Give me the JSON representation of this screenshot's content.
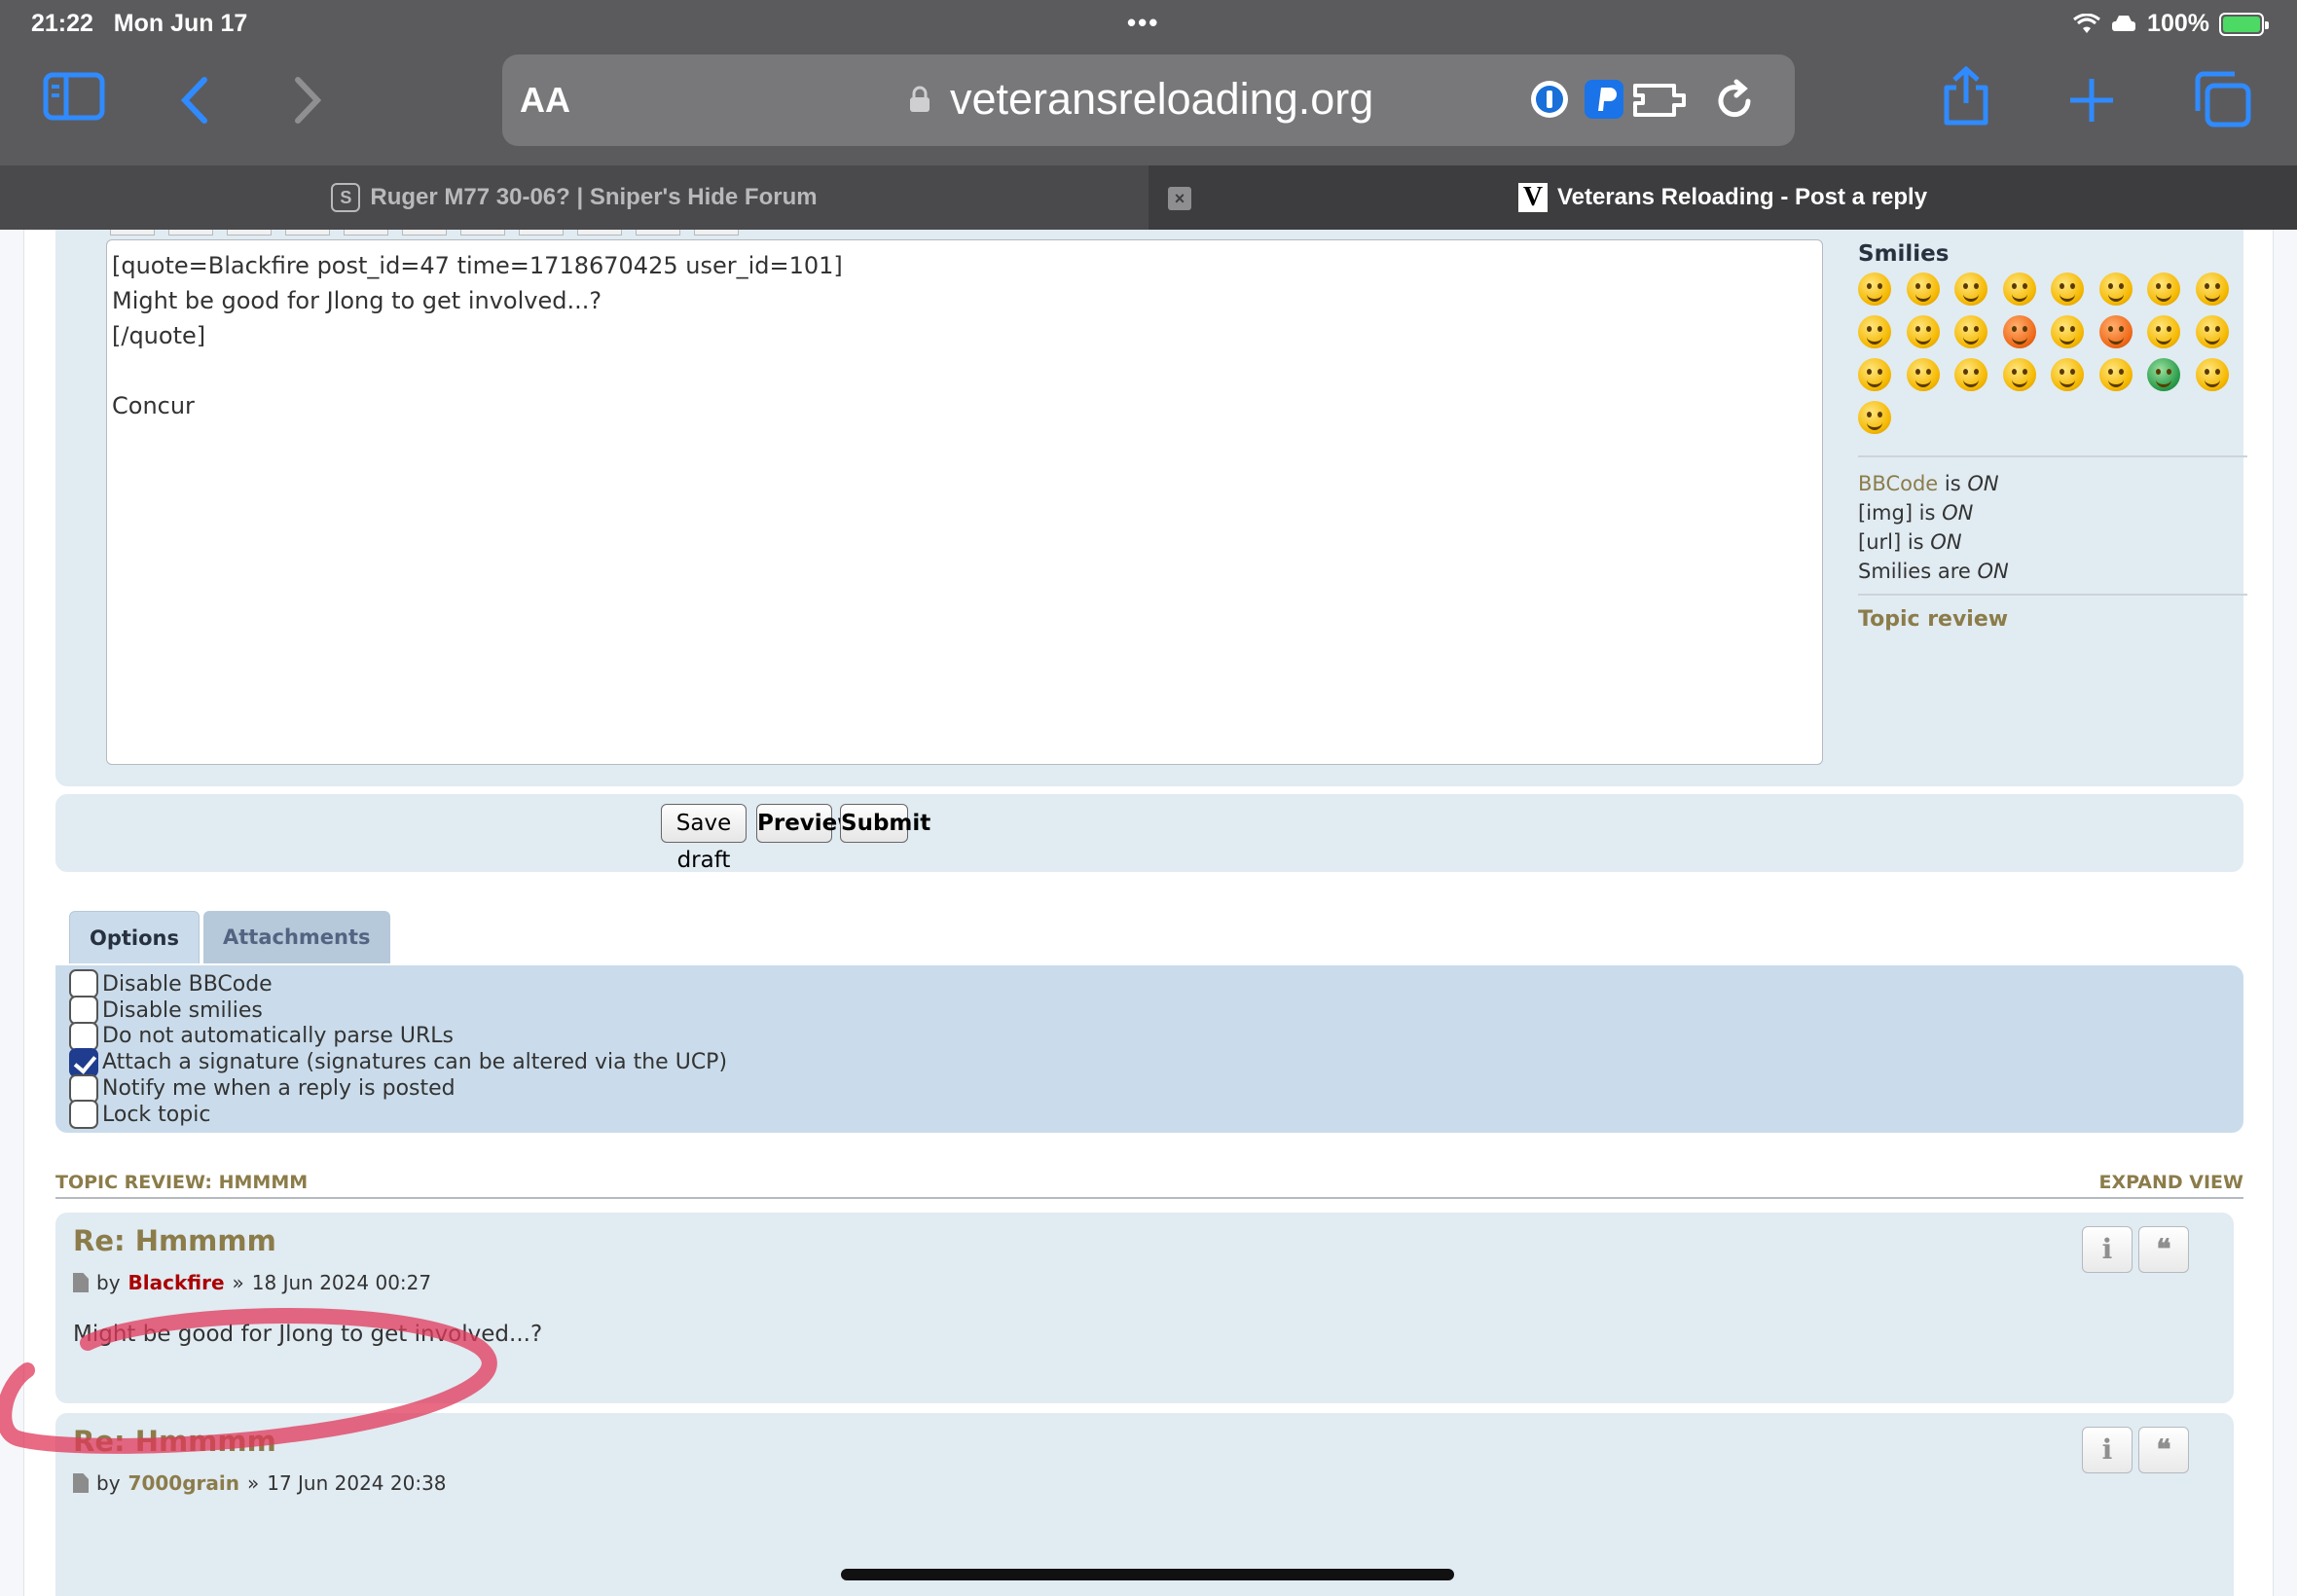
{
  "status_bar": {
    "time": "21:22",
    "date": "Mon Jun 17",
    "battery": "100%"
  },
  "browser": {
    "reader_label": "AA",
    "host": "veteransreloading.org",
    "tabs": [
      {
        "title": "Ruger M77 30-06? | Sniper's Hide Forum",
        "favicon": "S",
        "active": false
      },
      {
        "title": "Veterans Reloading - Post a reply",
        "favicon": "V",
        "active": true
      }
    ],
    "close_glyph": "×"
  },
  "editor": {
    "message": "[quote=Blackfire post_id=47 time=1718670425 user_id=101]\nMight be good for Jlong to get involved...?\n[/quote]\n\nConcur"
  },
  "smilies": {
    "heading": "Smilies",
    "count": 25,
    "red_indices": [
      11,
      13
    ],
    "green_indices": [
      22
    ],
    "status": {
      "bbcode_link": "BBCode",
      "bbcode_is": " is ",
      "bbcode_state": "ON",
      "img_label": "[img] is ",
      "img_state": "ON",
      "url_label": "[url] is ",
      "url_state": "ON",
      "smilies_label": "Smilies are ",
      "smilies_state": "ON"
    },
    "topic_review_link": "Topic review"
  },
  "buttons": {
    "save_draft": "Save draft",
    "preview": "Preview",
    "submit": "Submit"
  },
  "option_tabs": {
    "options": "Options",
    "attachments": "Attachments"
  },
  "options": [
    {
      "label": "Disable BBCode",
      "checked": false
    },
    {
      "label": "Disable smilies",
      "checked": false
    },
    {
      "label": "Do not automatically parse URLs",
      "checked": false
    },
    {
      "label": "Attach a signature (signatures can be altered via the UCP)",
      "checked": true
    },
    {
      "label": "Notify me when a reply is posted",
      "checked": false
    },
    {
      "label": "Lock topic",
      "checked": false
    }
  ],
  "review": {
    "header": "TOPIC REVIEW: HMMMM",
    "expand": "EXPAND VIEW",
    "posts": [
      {
        "title": "Re: Hmmmm",
        "by": "by",
        "author": "Blackfire",
        "sep": "»",
        "date": "18 Jun 2024 00:27",
        "body": "Might be good for Jlong to get involved...?"
      },
      {
        "title": "Re: Hmmmm",
        "by": "by",
        "author": "7000grain",
        "sep": "»",
        "date": "17 Jun 2024 20:38",
        "body": ""
      }
    ],
    "info_glyph": "i",
    "quote_glyph": "❝"
  },
  "colors": {
    "accent": "#2f8bff",
    "panel": "#e1ebf2",
    "options_panel": "#cadceb",
    "olive": "#8b7c4a",
    "author_red": "#aa0000",
    "annotation": "#e0385a"
  }
}
